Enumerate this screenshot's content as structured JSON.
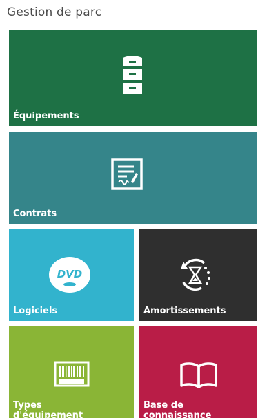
{
  "section": {
    "title": "Gestion de parc"
  },
  "tiles": [
    {
      "label": "Équipements",
      "icon": "filing-cabinet-icon",
      "color": "#1e7145"
    },
    {
      "label": "Contrats",
      "icon": "signed-contract-icon",
      "color": "#35858a"
    },
    {
      "label": "Logiciels",
      "icon": "dvd-icon",
      "color": "#32b3cd"
    },
    {
      "label": "Amortissements",
      "icon": "hourglass-refresh-icon",
      "color": "#2f2f2f"
    },
    {
      "label": "Types\nd'équipement",
      "icon": "barcode-icon",
      "color": "#8ab536"
    },
    {
      "label": "Base de\nconnaissance",
      "icon": "open-book-icon",
      "color": "#b91d47"
    }
  ]
}
